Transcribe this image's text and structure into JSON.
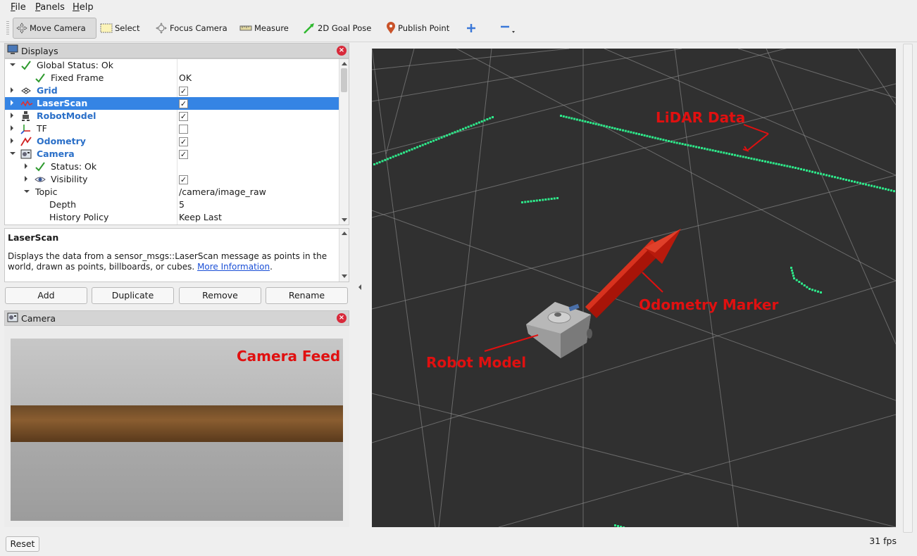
{
  "menu": {
    "items": [
      "File",
      "Panels",
      "Help"
    ]
  },
  "toolbar": {
    "tools": [
      {
        "label": "Move Camera",
        "icon": "move-camera-icon",
        "active": true
      },
      {
        "label": "Select",
        "icon": "select-icon"
      },
      {
        "label": "Focus Camera",
        "icon": "focus-camera-icon"
      },
      {
        "label": "Measure",
        "icon": "measure-icon"
      },
      {
        "label": "2D Goal Pose",
        "icon": "goal-pose-icon"
      },
      {
        "label": "Publish Point",
        "icon": "publish-point-icon"
      }
    ],
    "add_icon": "plus-icon",
    "remove_icon": "minus-icon"
  },
  "displays_panel": {
    "title": "Displays",
    "rows": [
      {
        "label": "Global Status: Ok",
        "value": ""
      },
      {
        "label": "Fixed Frame",
        "value": "OK"
      },
      {
        "label": "Grid",
        "checked": true
      },
      {
        "label": "LaserScan",
        "checked": true,
        "selected": true
      },
      {
        "label": "RobotModel",
        "checked": true
      },
      {
        "label": "TF",
        "checked": false
      },
      {
        "label": "Odometry",
        "checked": true
      },
      {
        "label": "Camera",
        "checked": true
      },
      {
        "label": "Status: Ok",
        "value": ""
      },
      {
        "label": "Visibility",
        "checked": true
      },
      {
        "label": "Topic",
        "value": "/camera/image_raw"
      },
      {
        "label": "Depth",
        "value": "5"
      },
      {
        "label": "History Policy",
        "value": "Keep Last"
      }
    ]
  },
  "description": {
    "title": "LaserScan",
    "text": "Displays the data from a sensor_msgs::LaserScan message as points in the world, drawn as points, billboards, or cubes.",
    "link": "More Information",
    "suffix": "."
  },
  "panel_buttons": {
    "add": "Add",
    "duplicate": "Duplicate",
    "remove": "Remove",
    "rename": "Rename"
  },
  "camera_panel": {
    "title": "Camera",
    "annotation": "Camera Feed"
  },
  "viewport": {
    "annotations": {
      "lidar": "LiDAR Data",
      "odometry": "Odometry Marker",
      "robot": "Robot Model"
    },
    "background": "#303030",
    "grid_color": "#a0a0a0",
    "scan_color": "#2ee88a",
    "arrow_color": "#c81a0c",
    "annotation_color": "#e01010"
  },
  "footer": {
    "reset": "Reset",
    "fps": "31 fps"
  },
  "colors": {
    "selection": "#3584e4",
    "link_blue": "#2a6fc8"
  }
}
